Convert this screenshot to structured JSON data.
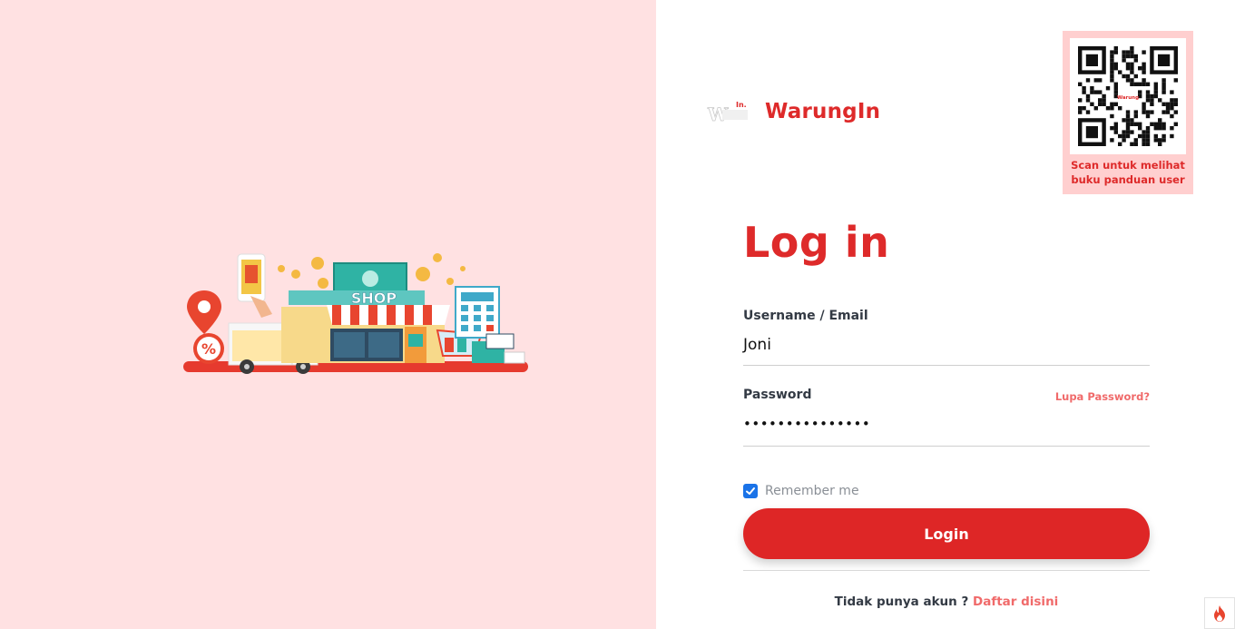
{
  "brand": {
    "name": "WarungIn",
    "logo_text": "WarungIn",
    "logo_superscript": "In."
  },
  "qr": {
    "caption_line1": "Scan untuk melihat",
    "caption_line2": "buku panduan user",
    "center_logo_text": "Warung"
  },
  "illustration": {
    "shop_sign": "SHOP",
    "discount_badge": "%"
  },
  "login": {
    "title": "Log in",
    "username_label": "Username / Email",
    "username_value": "Joni",
    "password_label": "Password",
    "password_value": "•••••••••••••••",
    "forgot_link": "Lupa Password?",
    "remember_label": "Remember me",
    "remember_checked": true,
    "button_label": "Login",
    "signup_prompt": "Tidak punya akun ?",
    "signup_link": "Daftar disini"
  },
  "colors": {
    "accent": "#de2a2a",
    "left_background": "#ffe1e2",
    "link": "#f06a6a",
    "qr_background": "#ffcfcf",
    "checkbox": "#1a73e8"
  }
}
